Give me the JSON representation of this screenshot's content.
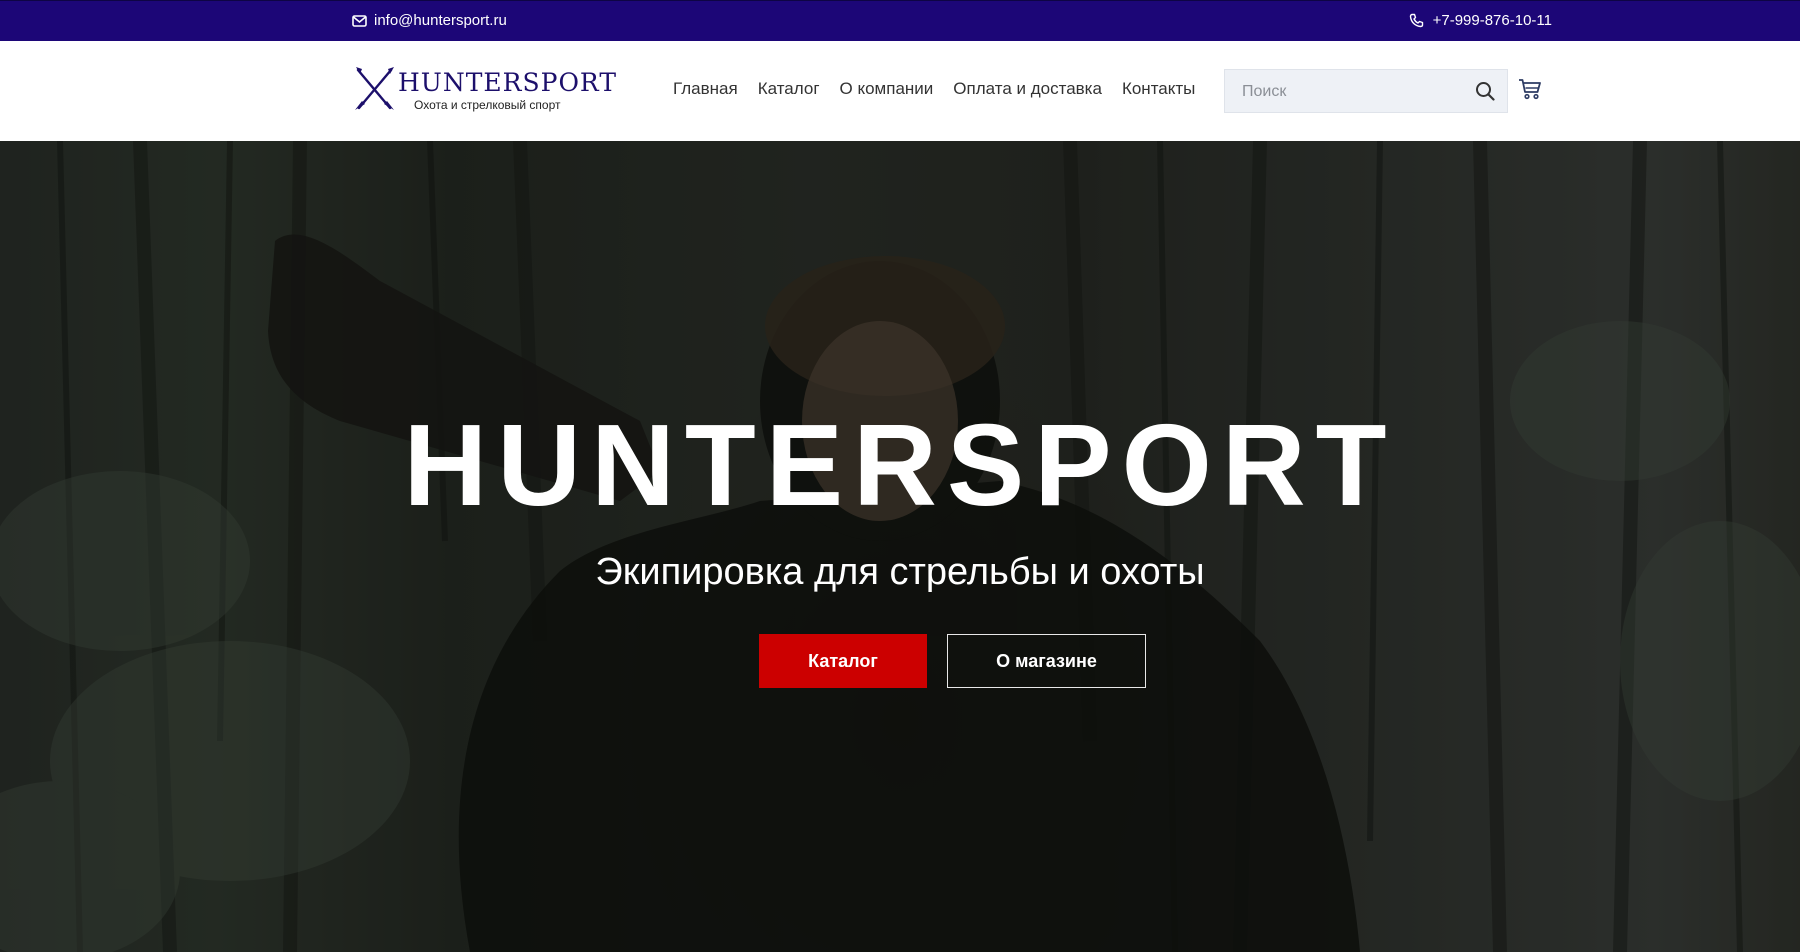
{
  "topbar": {
    "email": "info@huntersport.ru",
    "phone": "+7-999-876-10-11",
    "email_icon": "envelope-icon",
    "phone_icon": "phone-icon",
    "background": "#1c0677"
  },
  "header": {
    "logo": {
      "name": "HUNTERSPORT",
      "tagline": "Охота и стрелковый спорт",
      "icon": "crossed-rifles-icon"
    },
    "nav": [
      {
        "label": "Главная"
      },
      {
        "label": "Каталог"
      },
      {
        "label": "О компании"
      },
      {
        "label": "Оплата и доставка"
      },
      {
        "label": "Контакты"
      }
    ],
    "search": {
      "placeholder": "Поиск",
      "icon": "search-icon"
    },
    "cart_icon": "cart-icon"
  },
  "hero": {
    "title": "HUNTERSPORT",
    "subtitle": "Экипировка для стрельбы и охоты",
    "primary_button": "Каталог",
    "secondary_button": "О магазине",
    "accent": "#cc0000"
  }
}
